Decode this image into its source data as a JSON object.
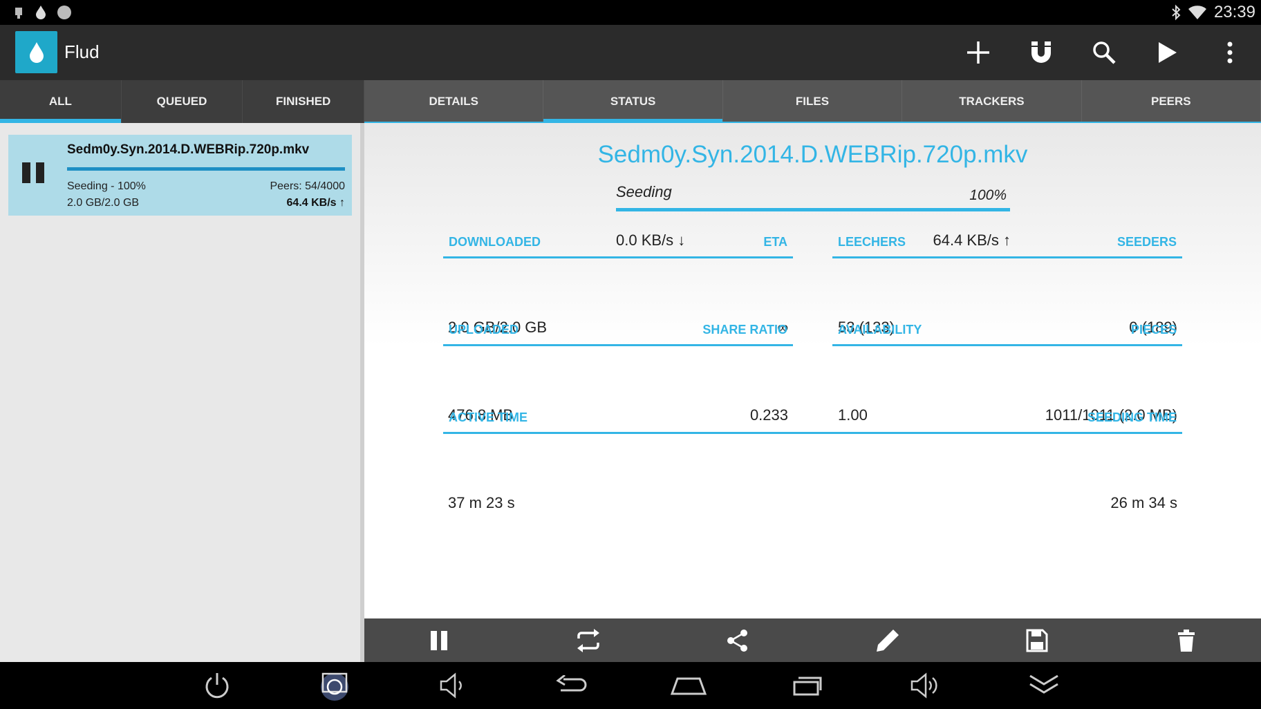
{
  "status_bar": {
    "time": "23:39",
    "left_icons": [
      "usb-icon",
      "flud-drop-icon",
      "circle-icon"
    ],
    "right_icons": [
      "bluetooth-icon",
      "wifi-icon"
    ]
  },
  "app": {
    "title": "Flud",
    "accent_color": "#33b5e5",
    "actions": [
      "add-icon",
      "magnet-icon",
      "search-icon",
      "play-icon",
      "overflow-menu-icon"
    ]
  },
  "list_tabs": [
    {
      "label": "ALL",
      "active": true
    },
    {
      "label": "QUEUED",
      "active": false
    },
    {
      "label": "FINISHED",
      "active": false
    }
  ],
  "detail_tabs": [
    {
      "label": "DETAILS",
      "active": false
    },
    {
      "label": "STATUS",
      "active": true
    },
    {
      "label": "FILES",
      "active": false
    },
    {
      "label": "TRACKERS",
      "active": false
    },
    {
      "label": "PEERS",
      "active": false
    }
  ],
  "torrent_item": {
    "name": "Sedm0y.Syn.2014.D.WEBRip.720p.mkv",
    "status": "Seeding - 100%",
    "size": "2.0 GB/2.0 GB",
    "peers": "Peers: 54/4000",
    "speed": "64.4 KB/s ↑",
    "progress": 1.0
  },
  "status": {
    "title": "Sedm0y.Syn.2014.D.WEBRip.720p.mkv",
    "state": "Seeding",
    "percent": "100%",
    "progress": 1.0,
    "down_speed": "0.0 KB/s ↓",
    "up_speed": "64.4 KB/s ↑",
    "downloaded_label": "DOWNLOADED",
    "downloaded": "2.0 GB/2.0 GB",
    "eta_label": "ETA",
    "eta": "∞",
    "leechers_label": "LEECHERS",
    "leechers": "53 (133)",
    "seeders_label": "SEEDERS",
    "seeders": "0 (189)",
    "uploaded_label": "UPLOADED",
    "uploaded": "476.8 MB",
    "share_ratio_label": "SHARE RATIO",
    "share_ratio": "0.233",
    "availability_label": "AVAILABILITY",
    "availability": "1.00",
    "pieces_label": "PIECES",
    "pieces": "1011/1011 (2.0 MB)",
    "active_time_label": "ACTIVE TIME",
    "active_time": "37 m 23 s",
    "seeding_time_label": "SEEDING TIME",
    "seeding_time": "26 m 34 s"
  },
  "torrent_toolbar": [
    "pause-icon",
    "recheck-icon",
    "share-icon",
    "edit-icon",
    "save-icon",
    "delete-icon"
  ],
  "nav_bar": [
    "power-icon",
    "screenshot-icon",
    "volume-down-icon",
    "back-icon",
    "home-icon",
    "recents-icon",
    "volume-up-icon",
    "collapse-icon"
  ]
}
